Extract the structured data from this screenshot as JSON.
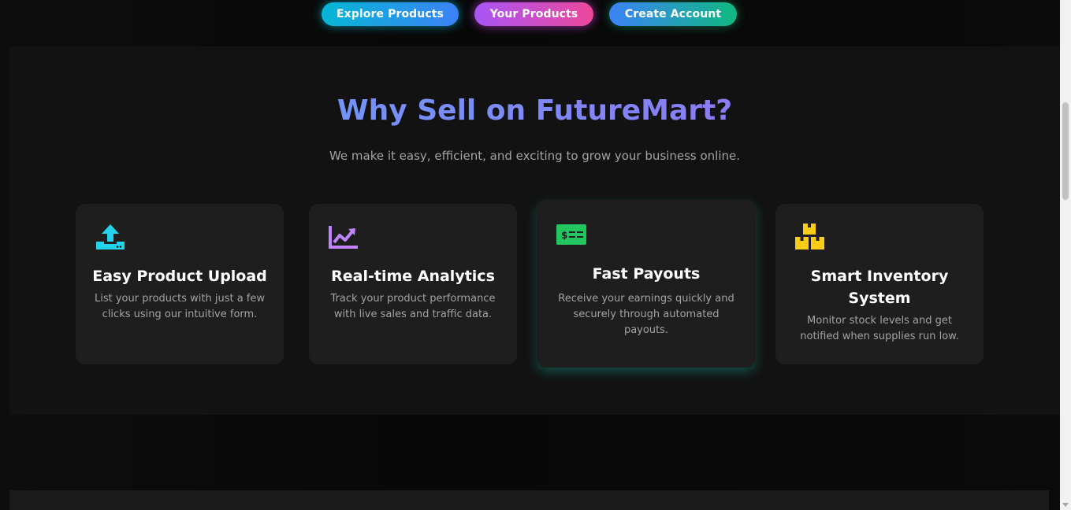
{
  "nav": {
    "explore": "Explore Products",
    "your_products": "Your Products",
    "create_account": "Create Account"
  },
  "section": {
    "title": "Why Sell on FutureMart?",
    "subtitle": "We make it easy, efficient, and exciting to grow your business online."
  },
  "features": [
    {
      "icon": "upload-icon",
      "icon_color": "#22d3ee",
      "title": "Easy Product Upload",
      "description_line1": "List your products with just a few",
      "description_line2": "clicks using our intuitive form."
    },
    {
      "icon": "chart-line-icon",
      "icon_color": "#c084fc",
      "title": "Real-time Analytics",
      "description_line1": "Track your product performance",
      "description_line2": "with live sales and traffic data."
    },
    {
      "icon": "money-bill-icon",
      "icon_color": "#22c55e",
      "title": "Fast Payouts",
      "description_line1": "Receive your earnings quickly and",
      "description_line2": "securely through automated",
      "description_line3": "payouts."
    },
    {
      "icon": "boxes-icon",
      "icon_color": "#facc15",
      "title_line1": "Smart Inventory",
      "title_line2": "System",
      "description_line1": "Monitor stock levels and get",
      "description_line2": "notified when supplies run low."
    }
  ],
  "colors": {
    "background": "#0a0a0a",
    "section_bg": "#121212",
    "card_bg": "#1e1e1e",
    "title_gradient_start": "#60a5fa",
    "title_gradient_end": "#a78bfa"
  }
}
